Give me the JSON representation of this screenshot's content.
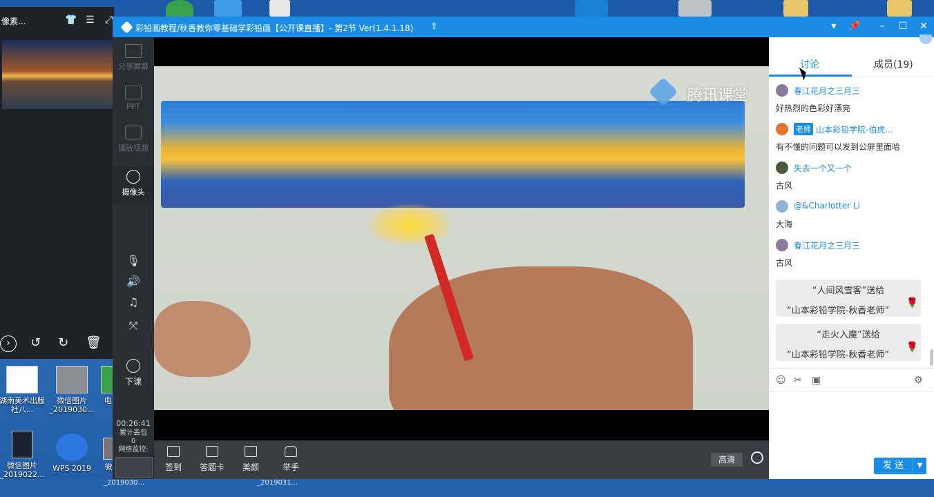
{
  "viewer": {
    "title": "像素...",
    "shirt_icon": "shirt-icon",
    "menu_icon": "menu-icon"
  },
  "window": {
    "title": "彩铅画教程/秋香教你零基础学彩铅画【公开课直播】- 第2节 Ver(1.4.1.18)",
    "accent_color": "#1a8ce6"
  },
  "sidebar": {
    "items": [
      {
        "label": "分享屏幕"
      },
      {
        "label": "PPT"
      },
      {
        "label": "播放视频"
      },
      {
        "label": "摄像头"
      }
    ],
    "end_class": "下课",
    "timer": "00:26:41",
    "lost_packets_label": "累计丢包",
    "lost_packets_value": "0",
    "network_label": "网络监控:"
  },
  "video": {
    "brand": "腾讯课堂"
  },
  "toolbar": {
    "items": [
      {
        "label": "签到"
      },
      {
        "label": "答题卡"
      },
      {
        "label": "美颜"
      },
      {
        "label": "举手"
      }
    ],
    "quality": "高清"
  },
  "chat": {
    "tabs": [
      {
        "label": "讨论"
      },
      {
        "label": "成员(19)"
      }
    ],
    "messages": [
      {
        "name": "春江花月之三月三",
        "text": "好热烈的色彩好漂亮"
      },
      {
        "badge": "老师",
        "name": "山本彩铅学院-伯虎...",
        "text": "有不懂的问题可以发到公屏里面哈"
      },
      {
        "name": "失去一个又一个",
        "text": "古风"
      },
      {
        "name": "@&Charlotter Li",
        "text": "大海"
      },
      {
        "name": "春江花月之三月三",
        "text": "古风"
      }
    ],
    "gifts": [
      {
        "line1": "“人间风雪客”送给",
        "line2": "“山本彩铅学院-秋香老师”"
      },
      {
        "line1": "“走火入魔”送给",
        "line2": "“山本彩铅学院-秋香老师”"
      }
    ],
    "send_label": "发 送"
  },
  "desktop": {
    "icons": [
      {
        "label": "湖南美术出版社八..."
      },
      {
        "label": "微信图片_2019030..."
      },
      {
        "label": "电"
      },
      {
        "label": "微信图片_2019022..."
      },
      {
        "label": "WPS 2019"
      },
      {
        "label": "微"
      }
    ],
    "taskbar_labels": [
      "_2019030...",
      "_2019031..."
    ]
  }
}
